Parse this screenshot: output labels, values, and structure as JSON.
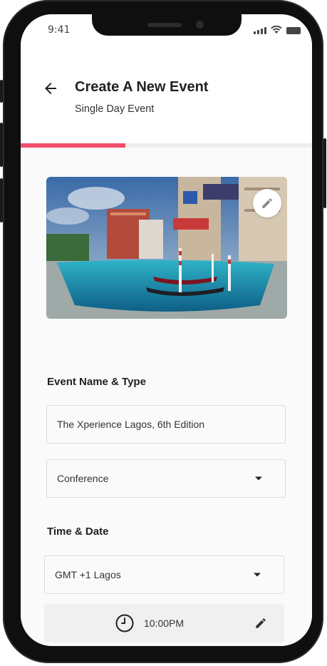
{
  "status_bar": {
    "time": "9:41"
  },
  "header": {
    "title": "Create A New Event",
    "subtitle": "Single Day Event"
  },
  "progress": {
    "fraction": 0.36,
    "color": "#f04e6a"
  },
  "cover_image": {
    "edit_icon": "pencil-icon"
  },
  "event_section": {
    "heading": "Event Name & Type",
    "name_value": "The Xperience Lagos, 6th Edition",
    "type_value": "Conference"
  },
  "time_section": {
    "heading": "Time & Date",
    "timezone_value": "GMT +1 Lagos",
    "time_value": "10:00PM"
  },
  "colors": {
    "accent": "#f04e6a",
    "background": "#fafafa"
  }
}
